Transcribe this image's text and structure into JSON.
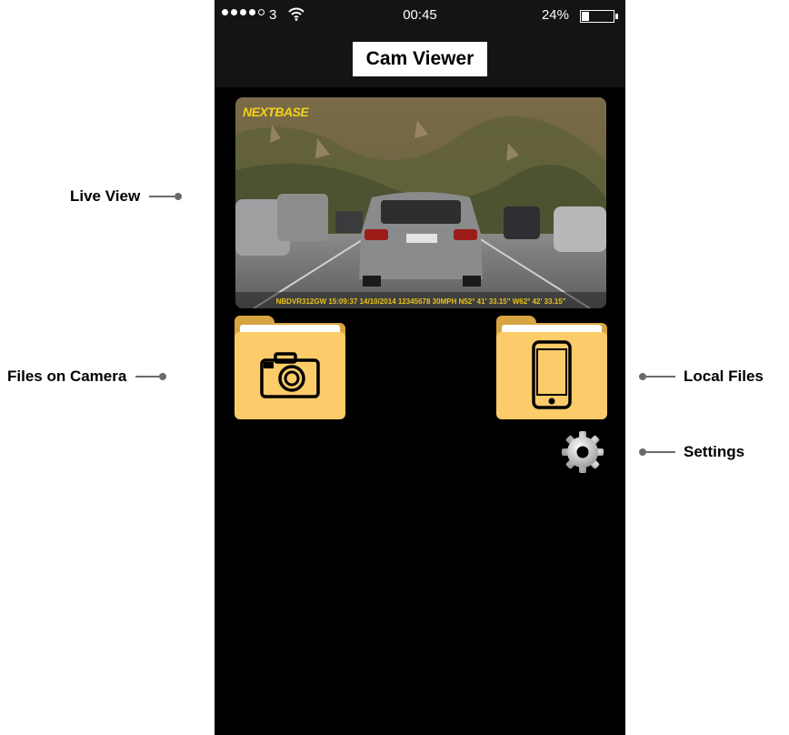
{
  "status_bar": {
    "carrier": "3",
    "time": "00:45",
    "battery_percent": "24%",
    "battery_level": 0.24
  },
  "app": {
    "title": "Cam Viewer"
  },
  "live_view": {
    "brand": "NEXTBASE",
    "overlay_text": "NBDVR312GW  15:09:37  14/10/2014  12345678  30MPH  N52° 41' 33.15\" W62° 42' 33.15\""
  },
  "buttons": {
    "files_on_camera_icon": "camera-icon",
    "local_files_icon": "phone-icon",
    "settings_icon": "gear-icon"
  },
  "callouts": {
    "live_view": "Live View",
    "files_on_camera": "Files on Camera",
    "local_files": "Local Files",
    "settings": "Settings"
  }
}
